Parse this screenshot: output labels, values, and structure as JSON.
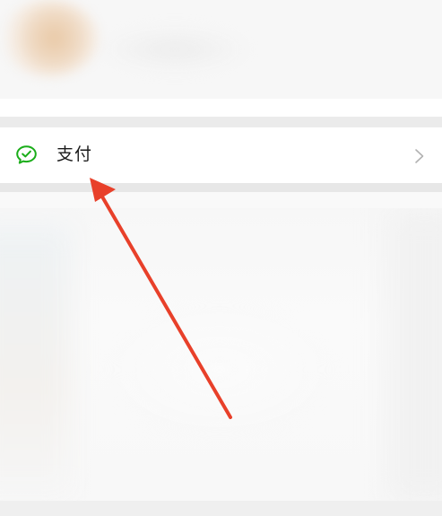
{
  "profile": {
    "avatar_icon": "avatar-blurred",
    "name_icon": "name-blurred"
  },
  "pay_item": {
    "label": "支付",
    "icon": "wechat-pay-icon",
    "chevron": "chevron-right-icon"
  },
  "annotation": {
    "arrow_icon": "red-arrow-pointing-to-pay"
  },
  "colors": {
    "background": "#ededed",
    "card": "#ffffff",
    "pay_icon_green": "#1aad19",
    "label_text": "#1a1a1a",
    "chevron": "#b2b2b2",
    "arrow_red": "#e8402a"
  }
}
